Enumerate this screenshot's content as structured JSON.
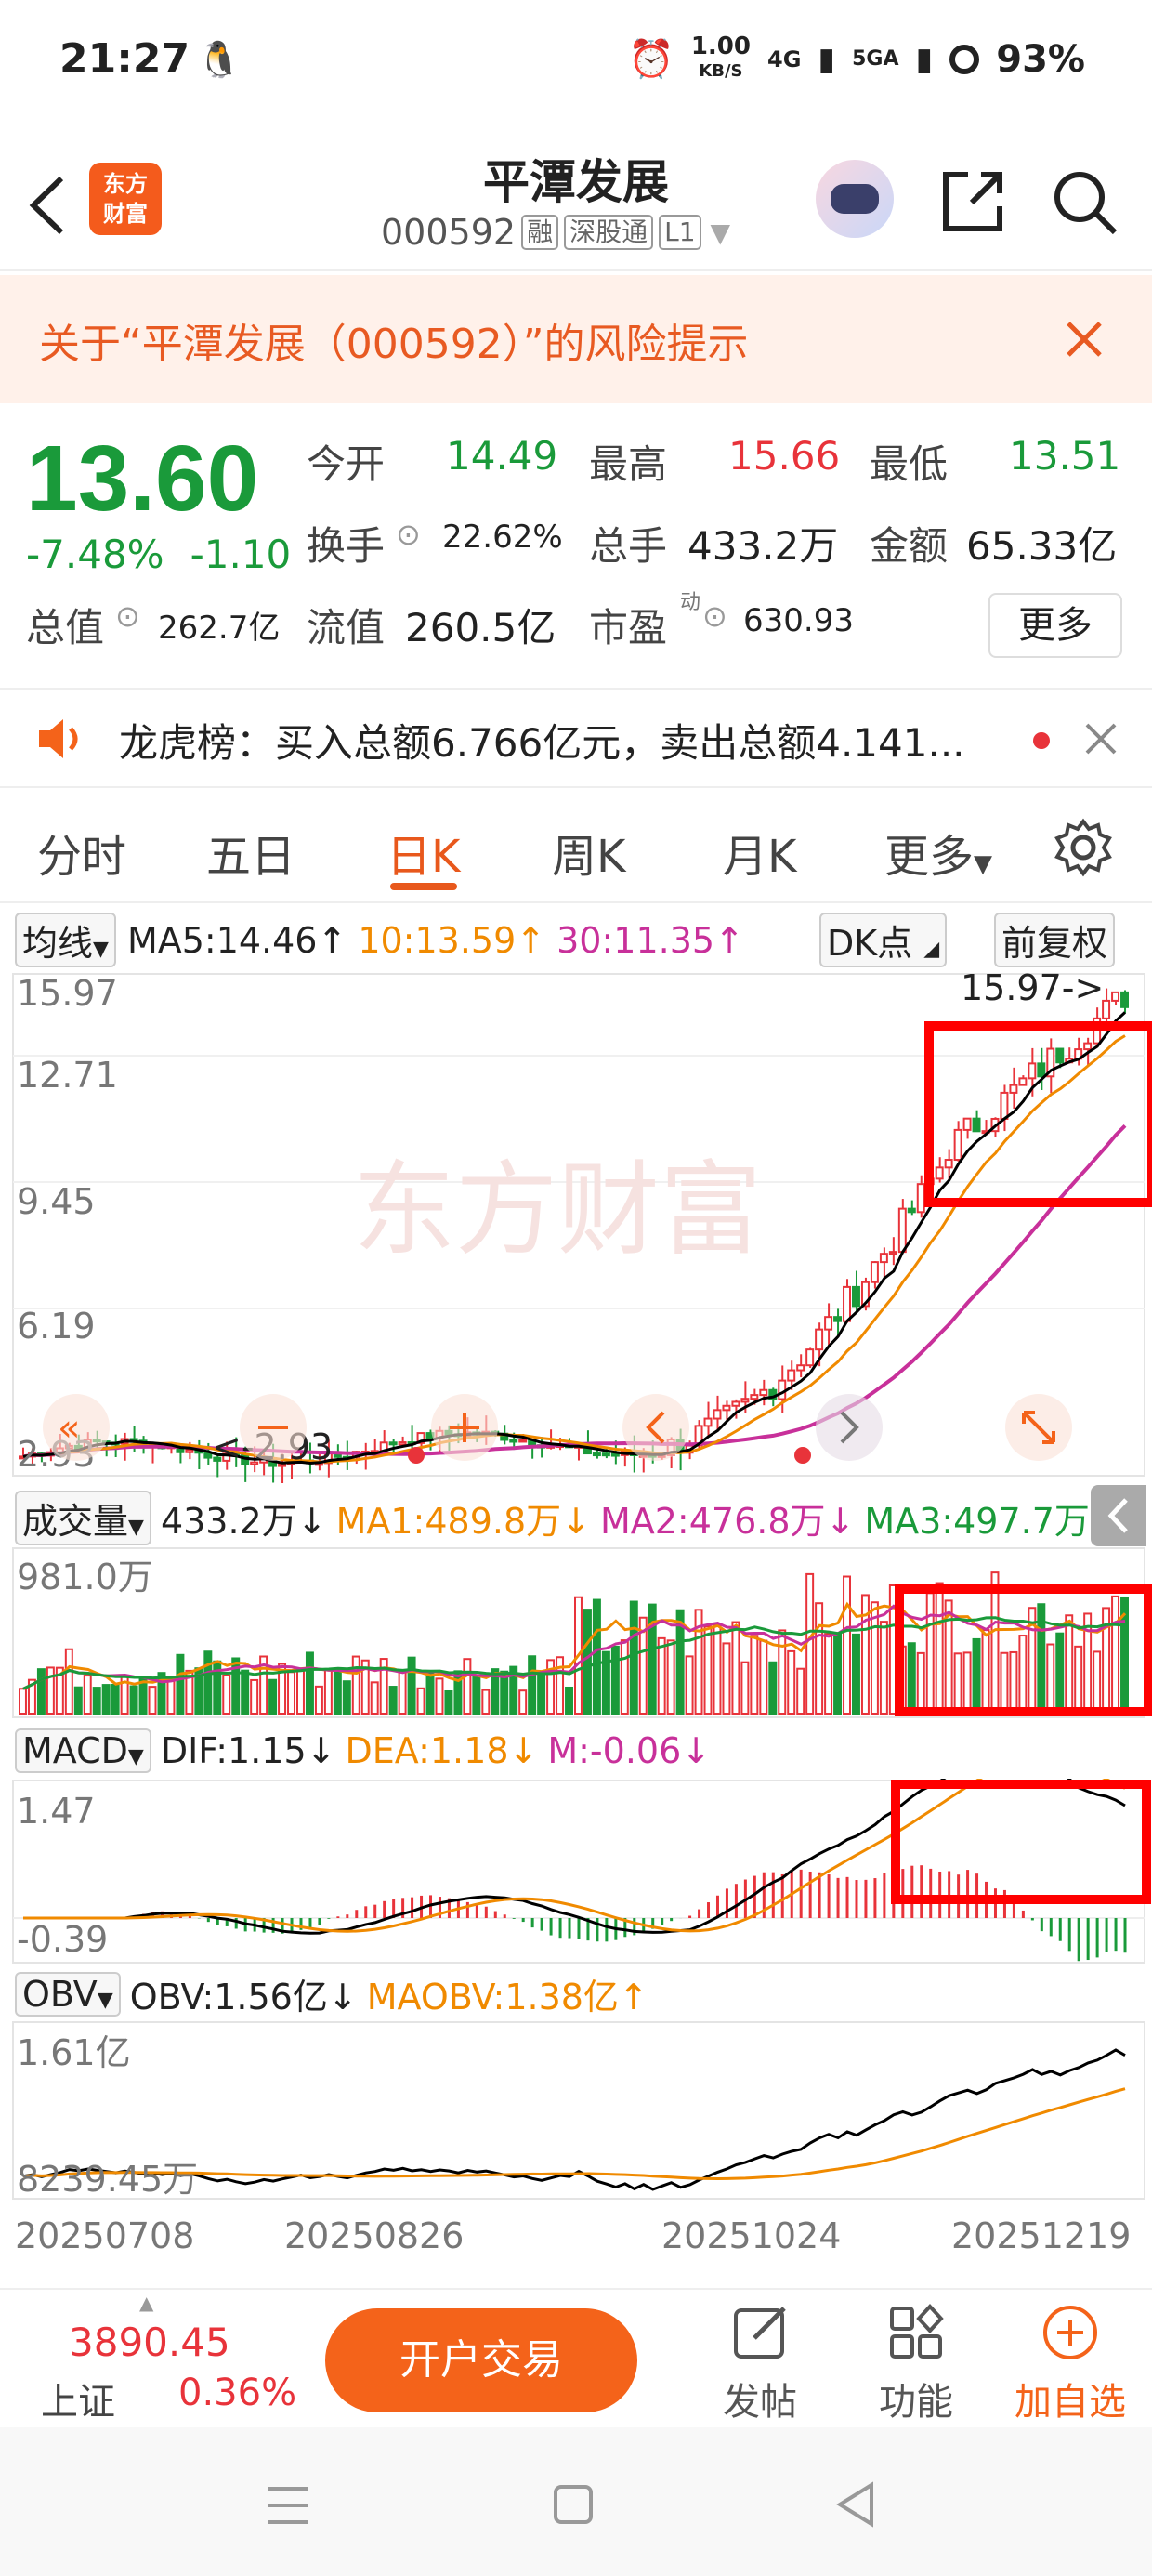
{
  "status": {
    "time": "21:27",
    "speed": "1.00",
    "speed_unit": "KB/S",
    "net1": "4G",
    "net2": "5GA",
    "battery": "93%"
  },
  "header": {
    "logo_line1": "东方",
    "logo_line2": "财富",
    "title": "平潭发展",
    "code": "000592",
    "tags": [
      "融",
      "深股通",
      "L1"
    ]
  },
  "risk": {
    "text": "关于“平潭发展（000592）”的风险提示"
  },
  "quote": {
    "price": "13.60",
    "pct": "-7.48%",
    "chg": "-1.10",
    "open_label": "今开",
    "open": "14.49",
    "high_label": "最高",
    "high": "15.66",
    "low_label": "最低",
    "low": "13.51",
    "turnover_label": "换手",
    "turnover": "22.62%",
    "volume_label": "总手",
    "volume": "433.2万",
    "amount_label": "金额",
    "amount": "65.33亿",
    "mktcap_label": "总值",
    "mktcap": "262.7亿",
    "float_label": "流值",
    "float": "260.5亿",
    "pe_label": "市盈",
    "pe_sup": "动",
    "pe": "630.93",
    "more": "更多"
  },
  "dragon": {
    "text": "龙虎榜：买入总额6.766亿元，卖出总额4.141..."
  },
  "tabs": [
    "分时",
    "五日",
    "日K",
    "周K",
    "月K",
    "更多"
  ],
  "kline": {
    "ma_btn": "均线",
    "ma5": "MA5:14.46↑",
    "ma10": "10:13.59↑",
    "ma30": "30:11.35↑",
    "dk_btn": "DK点",
    "fq_btn": "前复权",
    "y_labels": [
      "15.97",
      "12.71",
      "9.45",
      "6.19",
      "2.93"
    ],
    "max_mark": "15.97->",
    "min_mark": "<-2.93",
    "watermark": "东方财富"
  },
  "volume": {
    "btn": "成交量",
    "val": "433.2万↓",
    "ma1": "MA1:489.8万↓",
    "ma2": "MA2:476.8万↓",
    "ma3": "MA3:497.7万↓",
    "y_label": "981.0万"
  },
  "macd": {
    "btn": "MACD",
    "dif": "DIF:1.15↓",
    "dea": "DEA:1.18↓",
    "m": "M:-0.06↓",
    "y_top": "1.47",
    "y_bot": "-0.39"
  },
  "obv": {
    "btn": "OBV",
    "obv": "OBV:1.56亿↓",
    "maobv": "MAOBV:1.38亿↑",
    "y_top": "1.61亿",
    "y_bot": "8239.45万"
  },
  "dates": [
    "20250708",
    "20250826",
    "20251024",
    "20251219"
  ],
  "bottom": {
    "index_val": "3890.45",
    "index_name": "上证",
    "index_pct": "0.36%",
    "open_btn": "开户交易",
    "post": "发帖",
    "func": "功能",
    "add": "加自选"
  },
  "colors": {
    "up": "#e8333a",
    "down": "#1a9a3a",
    "accent": "#f4631a",
    "ma5": "#000000",
    "ma10": "#f08a00",
    "ma30": "#c8309a"
  },
  "icons": [
    "back-icon",
    "qq-icon",
    "alarm-icon",
    "signal-icon",
    "battery-icon",
    "robot-avatar",
    "share-icon",
    "search-icon",
    "close-icon",
    "speaker-icon",
    "settings-icon",
    "edit-icon",
    "grid-icon",
    "plus-circle-icon"
  ]
}
